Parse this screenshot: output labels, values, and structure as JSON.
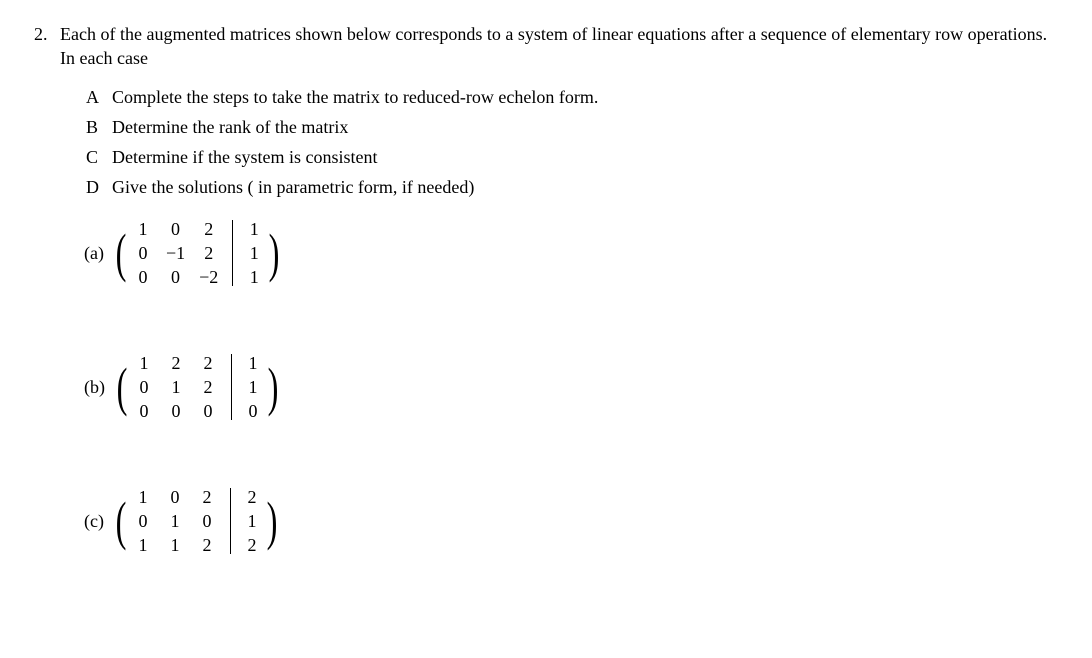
{
  "problem": {
    "number": "2.",
    "intro": "Each of the augmented matrices shown below corresponds to a system of linear equations after a sequence of elementary row operations. In each case",
    "subparts": [
      {
        "label": "A",
        "text": "Complete the steps to take the matrix to reduced-row echelon form."
      },
      {
        "label": "B",
        "text": "Determine the rank of the matrix"
      },
      {
        "label": "C",
        "text": "Determine if the system is consistent"
      },
      {
        "label": "D",
        "text": "Give the solutions ( in parametric form, if needed)"
      }
    ],
    "items": [
      {
        "label": "(a)",
        "coef": [
          [
            "1",
            "0",
            "2"
          ],
          [
            "0",
            "−1",
            "2"
          ],
          [
            "0",
            "0",
            "−2"
          ]
        ],
        "aug": [
          "1",
          "1",
          "1"
        ]
      },
      {
        "label": "(b)",
        "coef": [
          [
            "1",
            "2",
            "2"
          ],
          [
            "0",
            "1",
            "2"
          ],
          [
            "0",
            "0",
            "0"
          ]
        ],
        "aug": [
          "1",
          "1",
          "0"
        ]
      },
      {
        "label": "(c)",
        "coef": [
          [
            "1",
            "0",
            "2"
          ],
          [
            "0",
            "1",
            "0"
          ],
          [
            "1",
            "1",
            "2"
          ]
        ],
        "aug": [
          "2",
          "1",
          "2"
        ]
      }
    ]
  }
}
